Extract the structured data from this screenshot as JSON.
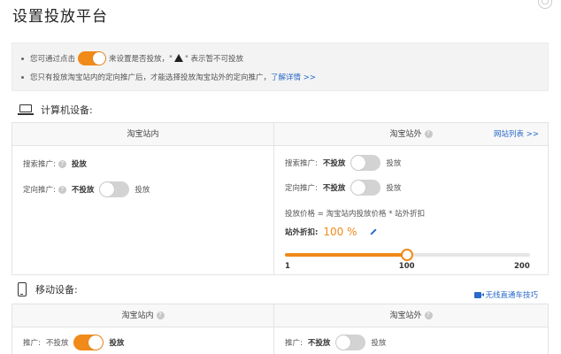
{
  "title": "设置投放平台",
  "close_glyph": "○",
  "notice": {
    "line1_pre": "您可通过点击",
    "line1_post": "来设置是否投放，\"",
    "line1_warn_tail": "\" 表示暂不可投放",
    "line2_text": "您只有投放淘宝站内的定向推广后，才能选择投放淘宝站外的定向推广，",
    "line2_link": "了解详情 >>"
  },
  "pc": {
    "heading": "计算机设备:",
    "inside": {
      "header": "淘宝站内",
      "search": {
        "label": "搜索推广:",
        "value": "投放"
      },
      "targeted": {
        "label": "定向推广:",
        "value": "不投放",
        "after": "投放",
        "on": false
      }
    },
    "outside": {
      "header": "淘宝站外",
      "site_list_link": "网站列表 >>",
      "search": {
        "label": "搜索推广:",
        "value": "不投放",
        "after": "投放",
        "on": false
      },
      "targeted": {
        "label": "定向推广:",
        "value": "不投放",
        "after": "投放",
        "on": false
      },
      "formula": "投放价格 = 淘宝站内投放价格 * 站外折扣",
      "discount_label": "站外折扣:",
      "discount_value": "100 %",
      "slider": {
        "min": 1,
        "max": 200,
        "value": 100,
        "tick_min": "1",
        "tick_mid": "100",
        "tick_max": "200"
      }
    }
  },
  "mobile": {
    "heading": "移动设备:",
    "tips_link": "无线直通车技巧",
    "inside": {
      "header": "淘宝站内",
      "promo": {
        "label": "推广:",
        "value": "不投放",
        "after": "投放",
        "on": true
      }
    },
    "outside": {
      "header": "淘宝站外",
      "promo": {
        "label": "推广:",
        "value": "不投放",
        "after": "投放",
        "on": false
      }
    }
  },
  "help_glyph": "?",
  "colors": {
    "accent": "#f08a19",
    "link": "#2a6ac8",
    "toggle_off": "#d3d3d3"
  }
}
